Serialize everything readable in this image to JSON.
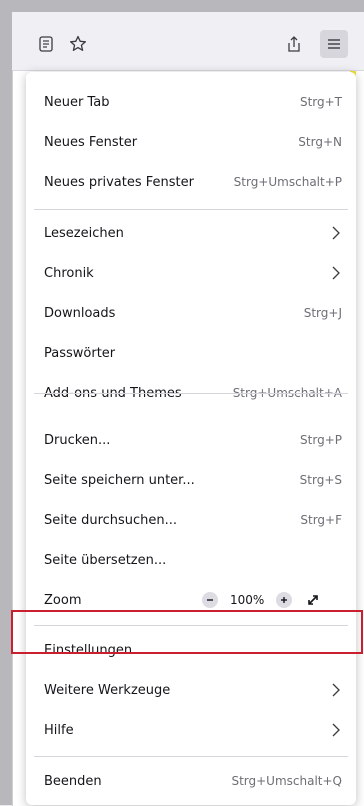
{
  "toolbar": {
    "icons": [
      "reader-view-icon",
      "bookmark-star-icon",
      "share-icon",
      "hamburger-menu-icon"
    ]
  },
  "menu": {
    "items": [
      {
        "label": "Neuer Tab",
        "shortcut": "Strg+T"
      },
      {
        "label": "Neues Fenster",
        "shortcut": "Strg+N"
      },
      {
        "label": "Neues privates Fenster",
        "shortcut": "Strg+Umschalt+P"
      },
      {
        "label": "Lesezeichen",
        "shortcut": ""
      },
      {
        "label": "Chronik",
        "shortcut": ""
      },
      {
        "label": "Downloads",
        "shortcut": "Strg+J"
      },
      {
        "label": "Passwörter",
        "shortcut": ""
      },
      {
        "label": "Add-ons und Themes",
        "shortcut": "Strg+Umschalt+A"
      },
      {
        "label": "Drucken...",
        "shortcut": "Strg+P"
      },
      {
        "label": "Seite speichern unter...",
        "shortcut": "Strg+S"
      },
      {
        "label": "Seite durchsuchen...",
        "shortcut": "Strg+F"
      },
      {
        "label": "Seite übersetzen...",
        "shortcut": ""
      },
      {
        "label": "Zoom",
        "shortcut": ""
      },
      {
        "label": "Einstellungen",
        "shortcut": ""
      },
      {
        "label": "Weitere Werkzeuge",
        "shortcut": ""
      },
      {
        "label": "Hilfe",
        "shortcut": ""
      },
      {
        "label": "Beenden",
        "shortcut": "Strg+Umschalt+Q"
      }
    ],
    "zoom": {
      "value": "100%",
      "minus": "−",
      "plus": "+"
    }
  },
  "colors": {
    "highlight": "#c8202f",
    "accent_strip": "#f2e23b"
  }
}
